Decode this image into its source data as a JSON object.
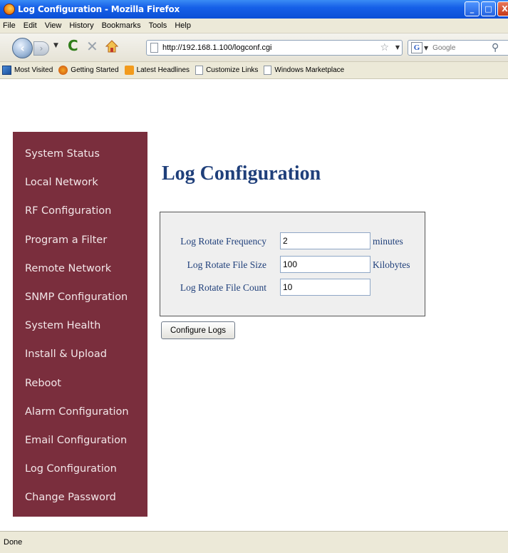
{
  "window": {
    "title": "Log Configuration - Mozilla Firefox",
    "minimize_glyph": "_",
    "maximize_glyph": "□",
    "close_glyph": "X"
  },
  "menu": [
    "File",
    "Edit",
    "View",
    "History",
    "Bookmarks",
    "Tools",
    "Help"
  ],
  "toolbar": {
    "back_glyph": "‹",
    "forward_glyph": "›",
    "dropdown_glyph": "▼",
    "reload_glyph": "C",
    "stop_glyph": "✕",
    "url": "http://192.168.1.100/logconf.cgi",
    "star_glyph": "☆",
    "search_engine_glyph": "G",
    "search_placeholder": "Google",
    "search_glyph": "⚲"
  },
  "bookmarks": [
    "Most Visited",
    "Getting Started",
    "Latest Headlines",
    "Customize Links",
    "Windows Marketplace"
  ],
  "sidebar": {
    "items": [
      "System Status",
      "Local Network",
      "RF Configuration",
      "Program a Filter",
      "Remote Network",
      "SNMP Configuration",
      "System Health",
      "Install & Upload",
      "Reboot",
      "Alarm Configuration",
      "Email Configuration",
      "Log Configuration",
      "Change Password"
    ]
  },
  "page": {
    "title": "Log Configuration",
    "fields": [
      {
        "label": "Log Rotate Frequency",
        "value": "2",
        "unit": "minutes"
      },
      {
        "label": "Log Rotate File Size",
        "value": "100",
        "unit": "Kilobytes"
      },
      {
        "label": "Log Rotate File Count",
        "value": "10",
        "unit": ""
      }
    ],
    "submit_label": "Configure Logs"
  },
  "status": {
    "text": "Done"
  },
  "colors": {
    "sidebar_bg": "#7a2e3d",
    "heading": "#1f3f7a",
    "titlebar": "#0b4fd6"
  }
}
